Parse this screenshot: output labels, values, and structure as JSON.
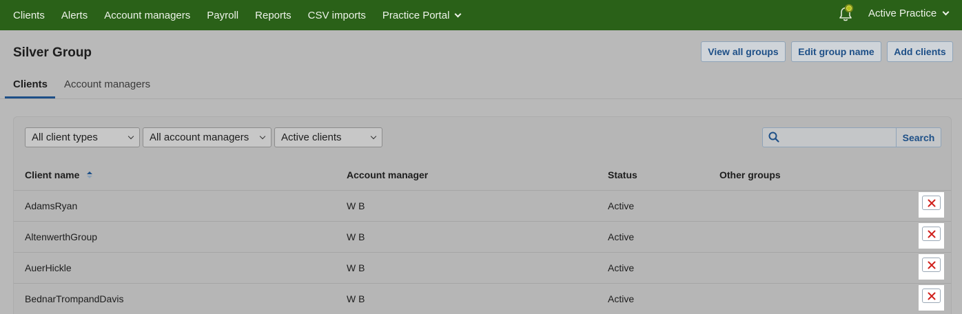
{
  "topnav": {
    "items": [
      {
        "label": "Clients"
      },
      {
        "label": "Alerts"
      },
      {
        "label": "Account managers"
      },
      {
        "label": "Payroll"
      },
      {
        "label": "Reports"
      },
      {
        "label": "CSV imports"
      },
      {
        "label": "Practice Portal"
      }
    ],
    "practice_label": "Active Practice"
  },
  "page": {
    "title": "Silver Group",
    "buttons": {
      "view_all_groups": "View all groups",
      "edit_group_name": "Edit group name",
      "add_clients": "Add clients"
    },
    "tabs": [
      {
        "label": "Clients",
        "active": true
      },
      {
        "label": "Account managers",
        "active": false
      }
    ]
  },
  "filters": {
    "client_type": "All client types",
    "account_manager": "All account managers",
    "status": "Active clients",
    "search_value": "",
    "search_button": "Search"
  },
  "table": {
    "headers": {
      "client_name": "Client name",
      "account_manager": "Account manager",
      "status": "Status",
      "other_groups": "Other groups"
    },
    "rows": [
      {
        "client_name": "AdamsRyan",
        "account_manager": "W B",
        "status": "Active",
        "other_groups": ""
      },
      {
        "client_name": "AltenwerthGroup",
        "account_manager": "W B",
        "status": "Active",
        "other_groups": ""
      },
      {
        "client_name": "AuerHickle",
        "account_manager": "W B",
        "status": "Active",
        "other_groups": ""
      },
      {
        "client_name": "BednarTrompandDavis",
        "account_manager": "W B",
        "status": "Active",
        "other_groups": ""
      }
    ]
  },
  "colors": {
    "nav_bg": "#2a6118",
    "link_blue": "#1d4f87",
    "remove_red": "#d0201c",
    "overlay_gray": "#b9b9b9"
  }
}
